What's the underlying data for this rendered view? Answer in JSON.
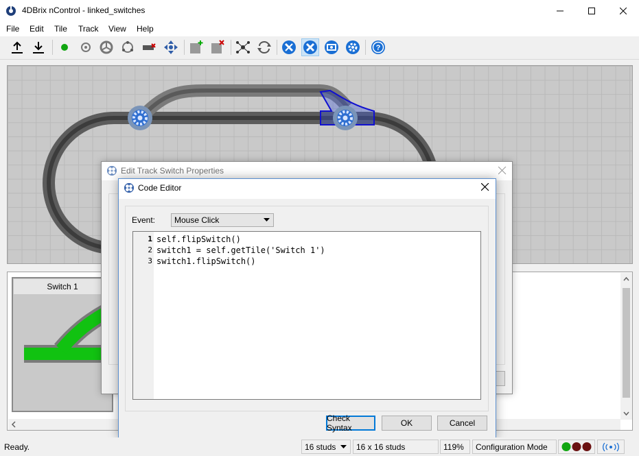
{
  "window": {
    "title": "4DBrix nControl - linked_switches"
  },
  "menu": {
    "items": [
      "File",
      "Edit",
      "Tile",
      "Track",
      "View",
      "Help"
    ]
  },
  "toolbar": {
    "icons": [
      "upload-icon",
      "download-icon",
      "green-dot-icon",
      "signal-icon",
      "wheel-icon",
      "circle-nodes-icon",
      "decoupler-icon",
      "cross-arrows-icon",
      "add-tile-icon",
      "delete-tile-icon",
      "network-icon",
      "refresh-icon",
      "tools-icon",
      "tools-active-icon",
      "device-icon",
      "settings-gear-icon",
      "help-icon"
    ],
    "accent": "#1a6fd4"
  },
  "preview": {
    "label": "Switch 1",
    "track_color": "#11c211"
  },
  "props_dialog": {
    "title": "Edit Track Switch Properties"
  },
  "code_editor": {
    "title": "Code Editor",
    "event_label": "Event:",
    "event_value": "Mouse Click",
    "lines": [
      {
        "num": "1",
        "text": "self.flipSwitch()"
      },
      {
        "num": "2",
        "text": "switch1 = self.getTile('Switch 1')"
      },
      {
        "num": "3",
        "text": "switch1.flipSwitch()"
      }
    ],
    "buttons": {
      "check": "Check Syntax",
      "ok": "OK",
      "cancel": "Cancel"
    }
  },
  "status": {
    "ready": "Ready.",
    "studs": "16 studs",
    "grid": "16 x 16 studs",
    "zoom": "119%",
    "mode": "Configuration Mode",
    "status_colors": [
      "#11a611",
      "#6b1212",
      "#6b1212"
    ]
  }
}
